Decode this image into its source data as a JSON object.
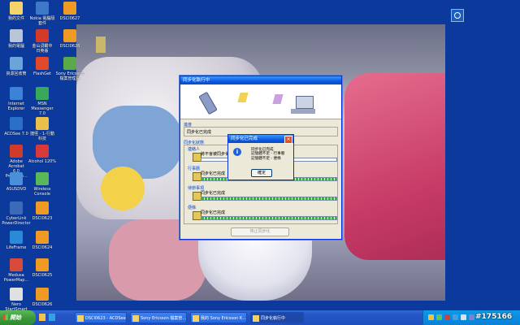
{
  "desktop_icons": [
    {
      "label": "我的文件",
      "color": "#f4d46b"
    },
    {
      "label": "Nokia 電腦隔\n套件",
      "color": "#3e78c8"
    },
    {
      "label": "DSCI0627",
      "color": "#f09a26"
    },
    {
      "label": "我的電腦",
      "color": "#b8c5d8"
    },
    {
      "label": "金山詞霸中\n日英版",
      "color": "#d23a2a"
    },
    {
      "label": "DSCI0628",
      "color": "#f09a26"
    },
    {
      "label": "資源回收筒",
      "color": "#6aa4d8"
    },
    {
      "label": "FlashGet",
      "color": "#e04a2a"
    },
    {
      "label": "Sony Ericsson\n檔案管理員",
      "color": "#5aaa4a"
    },
    {
      "label": "Internet\nExplorer",
      "color": "#3c82d8"
    },
    {
      "label": "MSN\nMessenger 7.0",
      "color": "#3aa85a"
    },
    {
      "label": "ACDSee 7.0",
      "color": "#2a70c8"
    },
    {
      "label": "捷徑 - 1-行動\n科技",
      "color": "#e9c14a"
    },
    {
      "label": "Adobe Acrobat\n6.0 Professio...",
      "color": "#d23a2a"
    },
    {
      "label": "Alcohol 120%",
      "color": "#d83a3a"
    },
    {
      "label": "ASUSDVD",
      "color": "#4a90d8"
    },
    {
      "label": "Wireless\nConsole",
      "color": "#5ab85a"
    },
    {
      "label": "CyberLink\nPowerDirector",
      "color": "#3a6ab8"
    },
    {
      "label": "DSCI0623",
      "color": "#f09a26"
    },
    {
      "label": "LifeFrame",
      "color": "#2a8ad8"
    },
    {
      "label": "DSCI0624",
      "color": "#f09a26"
    },
    {
      "label": "Medusa\nPowerMap...",
      "color": "#d84a3a"
    },
    {
      "label": "DSCI0625",
      "color": "#f09a26"
    },
    {
      "label": "Nero\nStartSmart",
      "color": "#e0e0e0"
    },
    {
      "label": "DSCI0626",
      "color": "#f09a26"
    }
  ],
  "sync_window": {
    "title": "同步化執行中",
    "progress_label": "進度",
    "progress_text": "同步化已完成",
    "status_label": "同步化狀態",
    "items": [
      {
        "header": "連絡人",
        "text": "將不會被同步化",
        "fill_pct": 0
      },
      {
        "header": "行事曆",
        "text": "同步化已完成",
        "fill_pct": 100
      },
      {
        "header": "待辦事項",
        "text": "同步化已完成",
        "fill_pct": 100
      },
      {
        "header": "便條",
        "text": "同步化已完成",
        "fill_pct": 100
      }
    ],
    "stop_button": "停止同步化"
  },
  "dialog": {
    "title": "同步化已完成",
    "close": "×",
    "icon_glyph": "i",
    "message_lines": [
      "同步化已完成",
      "記憶體不足 - 行事曆",
      "記憶體不足 - 便條"
    ],
    "ok_button": "確定"
  },
  "taskbar": {
    "start_label": "開始",
    "buttons": [
      {
        "label": "DSCI0623 - ACDSee ...",
        "active": false
      },
      {
        "label": "Sony Ericsson 檔案管...",
        "active": false
      },
      {
        "label": "我的 Sony Ericsson K...",
        "active": false
      },
      {
        "label": "同步化執行中",
        "active": true
      }
    ]
  },
  "watermark": "#175166"
}
